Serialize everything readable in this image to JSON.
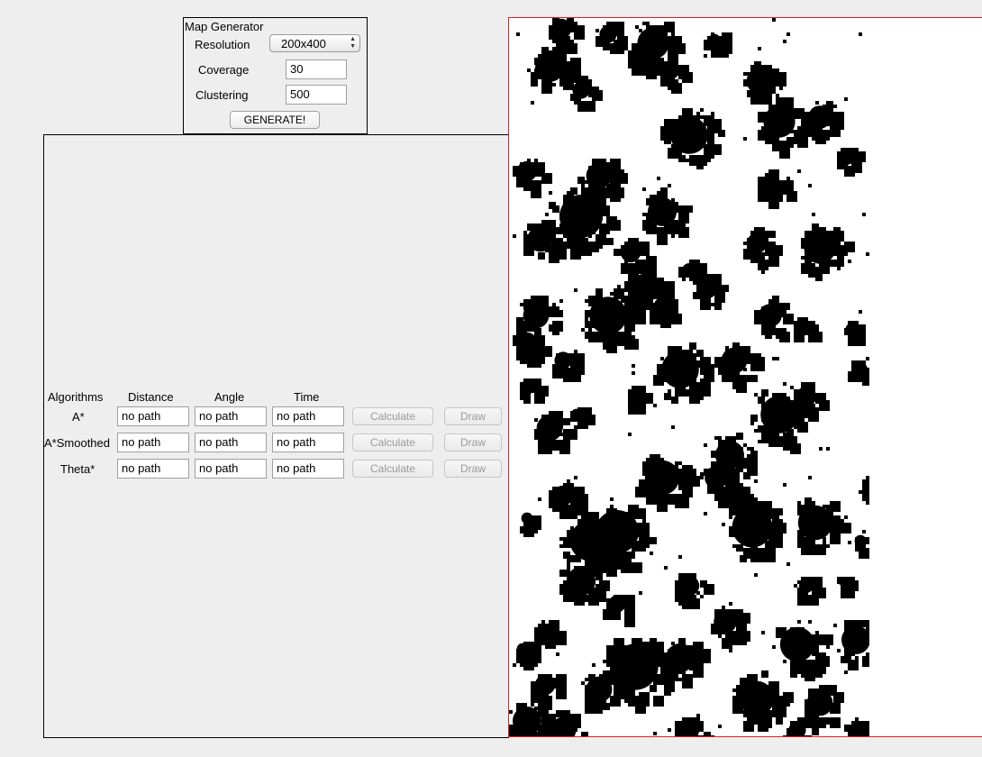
{
  "generator": {
    "title": "Map Generator",
    "resolution_label": "Resolution",
    "resolution_value": "200x400",
    "coverage_label": "Coverage",
    "coverage_value": "30",
    "clustering_label": "Clustering",
    "clustering_value": "500",
    "generate_label": "GENERATE!"
  },
  "algorithms": {
    "headers": {
      "algorithms": "Algorithms",
      "distance": "Distance",
      "angle": "Angle",
      "time": "Time"
    },
    "rows": [
      {
        "name": "A*",
        "distance": "no path",
        "angle": "no path",
        "time": "no path",
        "calculate": "Calculate",
        "draw": "Draw"
      },
      {
        "name": "A*Smoothed",
        "distance": "no path",
        "angle": "no path",
        "time": "no path",
        "calculate": "Calculate",
        "draw": "Draw"
      },
      {
        "name": "Theta*",
        "distance": "no path",
        "angle": "no path",
        "time": "no path",
        "calculate": "Calculate",
        "draw": "Draw"
      }
    ]
  },
  "map": {
    "obstacle_color": "#000000",
    "free_color": "#ffffff",
    "border_color": "#e02020"
  }
}
